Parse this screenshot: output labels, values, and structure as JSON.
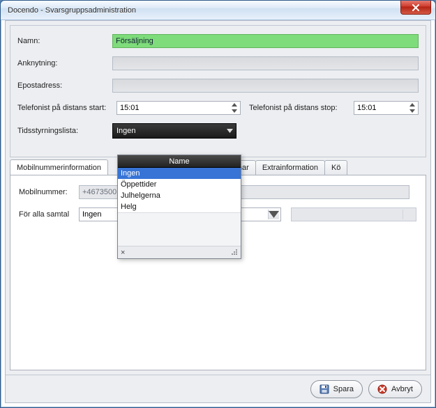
{
  "window": {
    "title": "Docendo - Svarsgruppsadministration"
  },
  "form": {
    "name_label": "Namn:",
    "name_value": "Försäljning",
    "ext_label": "Anknytning:",
    "email_label": "Epostadress:",
    "tele_start_label": "Telefonist på distans start:",
    "tele_start_value": "15:01",
    "tele_stop_label": "Telefonist på distans stop:",
    "tele_stop_value": "15:01",
    "schedule_label": "Tidsstyrningslista:",
    "schedule_value": "Ingen"
  },
  "dropdown": {
    "header": "Name",
    "items": [
      "Ingen",
      "Öppettider",
      "Julhelgerna",
      "Helg"
    ],
    "selected_index": 0,
    "close_glyph": "×"
  },
  "tabs": {
    "items": [
      "Mobilnummerinformation",
      "dlemmar",
      "Extrainformation",
      "Kö"
    ],
    "active_index": 0
  },
  "panel": {
    "mobil_label": "Mobilnummer:",
    "mobil_value": "+4673500",
    "alla_label": "För alla samtal",
    "alla_value": "Ingen"
  },
  "footer": {
    "save": "Spara",
    "cancel": "Avbryt"
  }
}
